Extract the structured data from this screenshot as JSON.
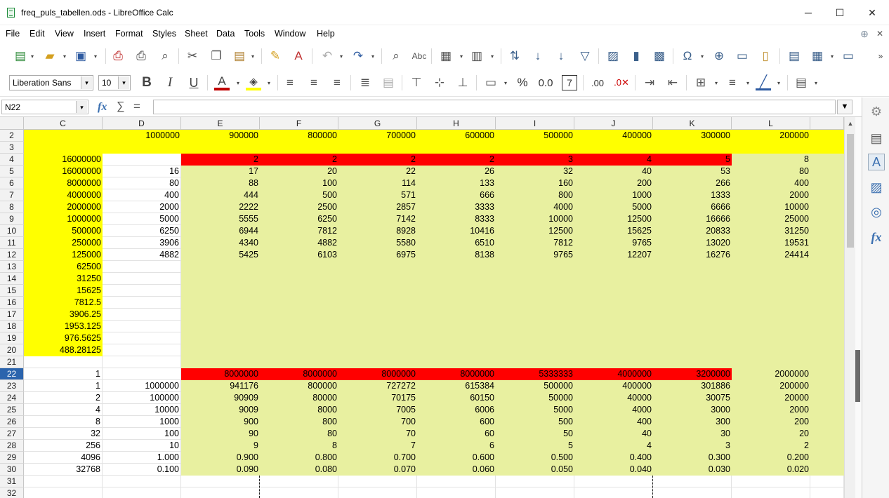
{
  "window": {
    "title": "freq_puls_tabellen.ods - LibreOffice Calc",
    "controls": {
      "minimize": "─",
      "maximize": "☐",
      "close": "✕"
    }
  },
  "menu": [
    "File",
    "Edit",
    "View",
    "Insert",
    "Format",
    "Styles",
    "Sheet",
    "Data",
    "Tools",
    "Window",
    "Help"
  ],
  "toolbar": {
    "font_name": "Liberation Sans",
    "font_size": "10"
  },
  "formula_bar": {
    "name_box": "N22",
    "function_wizard": "fx",
    "sum": "∑",
    "equals": "=",
    "content": ""
  },
  "colors": {
    "yellow": "#ffff00",
    "light_green": "#e8f0a0",
    "red": "#ff0000",
    "selection": "#2b64ad"
  },
  "sheet": {
    "columns": [
      "C",
      "D",
      "E",
      "F",
      "G",
      "H",
      "I",
      "J",
      "K",
      "L"
    ],
    "rows": [
      {
        "n": "2",
        "cells": [
          "",
          "1000000",
          "900000",
          "800000",
          "700000",
          "600000",
          "500000",
          "400000",
          "300000",
          "200000"
        ]
      },
      {
        "n": "3",
        "cells": [
          "",
          "",
          "",
          "",
          "",
          "",
          "",
          "",
          "",
          ""
        ]
      },
      {
        "n": "4",
        "cells": [
          "16000000",
          "",
          "2",
          "2",
          "2",
          "2",
          "3",
          "4",
          "5",
          "8"
        ]
      },
      {
        "n": "5",
        "cells": [
          "16000000",
          "16",
          "17",
          "20",
          "22",
          "26",
          "32",
          "40",
          "53",
          "80"
        ]
      },
      {
        "n": "6",
        "cells": [
          "8000000",
          "80",
          "88",
          "100",
          "114",
          "133",
          "160",
          "200",
          "266",
          "400"
        ]
      },
      {
        "n": "7",
        "cells": [
          "4000000",
          "400",
          "444",
          "500",
          "571",
          "666",
          "800",
          "1000",
          "1333",
          "2000"
        ]
      },
      {
        "n": "8",
        "cells": [
          "2000000",
          "2000",
          "2222",
          "2500",
          "2857",
          "3333",
          "4000",
          "5000",
          "6666",
          "10000"
        ]
      },
      {
        "n": "9",
        "cells": [
          "1000000",
          "5000",
          "5555",
          "6250",
          "7142",
          "8333",
          "10000",
          "12500",
          "16666",
          "25000"
        ]
      },
      {
        "n": "10",
        "cells": [
          "500000",
          "6250",
          "6944",
          "7812",
          "8928",
          "10416",
          "12500",
          "15625",
          "20833",
          "31250"
        ]
      },
      {
        "n": "11",
        "cells": [
          "250000",
          "3906",
          "4340",
          "4882",
          "5580",
          "6510",
          "7812",
          "9765",
          "13020",
          "19531"
        ]
      },
      {
        "n": "12",
        "cells": [
          "125000",
          "4882",
          "5425",
          "6103",
          "6975",
          "8138",
          "9765",
          "12207",
          "16276",
          "24414"
        ]
      },
      {
        "n": "13",
        "cells": [
          "62500",
          "",
          "",
          "",
          "",
          "",
          "",
          "",
          "",
          ""
        ]
      },
      {
        "n": "14",
        "cells": [
          "31250",
          "",
          "",
          "",
          "",
          "",
          "",
          "",
          "",
          ""
        ]
      },
      {
        "n": "15",
        "cells": [
          "15625",
          "",
          "",
          "",
          "",
          "",
          "",
          "",
          "",
          ""
        ]
      },
      {
        "n": "16",
        "cells": [
          "7812.5",
          "",
          "",
          "",
          "",
          "",
          "",
          "",
          "",
          ""
        ]
      },
      {
        "n": "17",
        "cells": [
          "3906.25",
          "",
          "",
          "",
          "",
          "",
          "",
          "",
          "",
          ""
        ]
      },
      {
        "n": "18",
        "cells": [
          "1953.125",
          "",
          "",
          "",
          "",
          "",
          "",
          "",
          "",
          ""
        ]
      },
      {
        "n": "19",
        "cells": [
          "976.5625",
          "",
          "",
          "",
          "",
          "",
          "",
          "",
          "",
          ""
        ]
      },
      {
        "n": "20",
        "cells": [
          "488.28125",
          "",
          "",
          "",
          "",
          "",
          "",
          "",
          "",
          ""
        ]
      },
      {
        "n": "21",
        "cells": [
          "",
          "",
          "",
          "",
          "",
          "",
          "",
          "",
          "",
          ""
        ]
      },
      {
        "n": "22",
        "cells": [
          "1",
          "",
          "8000000",
          "8000000",
          "8000000",
          "8000000",
          "5333333",
          "4000000",
          "3200000",
          "2000000"
        ]
      },
      {
        "n": "23",
        "cells": [
          "1",
          "1000000",
          "941176",
          "800000",
          "727272",
          "615384",
          "500000",
          "400000",
          "301886",
          "200000"
        ]
      },
      {
        "n": "24",
        "cells": [
          "2",
          "100000",
          "90909",
          "80000",
          "70175",
          "60150",
          "50000",
          "40000",
          "30075",
          "20000"
        ]
      },
      {
        "n": "25",
        "cells": [
          "4",
          "10000",
          "9009",
          "8000",
          "7005",
          "6006",
          "5000",
          "4000",
          "3000",
          "2000"
        ]
      },
      {
        "n": "26",
        "cells": [
          "8",
          "1000",
          "900",
          "800",
          "700",
          "600",
          "500",
          "400",
          "300",
          "200"
        ]
      },
      {
        "n": "27",
        "cells": [
          "32",
          "100",
          "90",
          "80",
          "70",
          "60",
          "50",
          "40",
          "30",
          "20"
        ]
      },
      {
        "n": "28",
        "cells": [
          "256",
          "10",
          "9",
          "8",
          "7",
          "6",
          "5",
          "4",
          "3",
          "2"
        ]
      },
      {
        "n": "29",
        "cells": [
          "4096",
          "1.000",
          "0.900",
          "0.800",
          "0.700",
          "0.600",
          "0.500",
          "0.400",
          "0.300",
          "0.200"
        ]
      },
      {
        "n": "30",
        "cells": [
          "32768",
          "0.100",
          "0.090",
          "0.080",
          "0.070",
          "0.060",
          "0.050",
          "0.040",
          "0.030",
          "0.020"
        ]
      },
      {
        "n": "31",
        "cells": [
          "",
          "",
          "",
          "",
          "",
          "",
          "",
          "",
          "",
          ""
        ]
      },
      {
        "n": "32",
        "cells": [
          "",
          "",
          "",
          "",
          "",
          "",
          "",
          "",
          "",
          ""
        ]
      }
    ]
  }
}
